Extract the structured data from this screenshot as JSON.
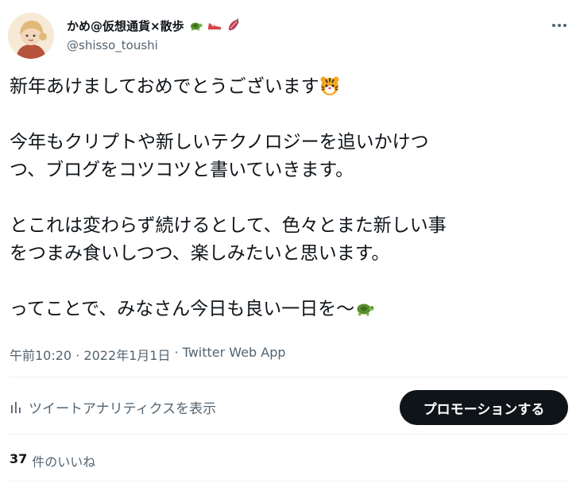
{
  "author": {
    "display_name": "かめ@仮想通貨×散歩",
    "handle": "@shisso_toushi",
    "name_emojis": [
      "turtle-icon",
      "sneaker-icon",
      "sweet-potato-icon"
    ]
  },
  "tweet": {
    "paragraphs": [
      [
        "新年あけましておめでとうございます"
      ],
      [
        "今年もクリプトや新しいテクノロジーを追いかけつ",
        "つ、ブログをコツコツと書いていきます。"
      ],
      [
        "とこれは変わらず続けるとして、色々とまた新しい事",
        "をつまみ食いしつつ、楽しみたいと思います。"
      ],
      [
        "ってことで、みなさん今日も良い一日を〜"
      ]
    ],
    "emojis": {
      "p0": "tiger-face-icon",
      "p3": "turtle-icon"
    }
  },
  "meta": {
    "time": "午前10:20",
    "separator": "·",
    "date": "2022年1月1日",
    "source": "Twitter Web App"
  },
  "actions": {
    "analytics_label": "ツイートアナリティクスを表示",
    "promote_label": "プロモーションする"
  },
  "likes": {
    "count": "37",
    "label": "件のいいね"
  },
  "colors": {
    "text": "#0f1419",
    "secondary": "#536471",
    "divider": "#eff3f4",
    "button_bg": "#0f1419"
  }
}
